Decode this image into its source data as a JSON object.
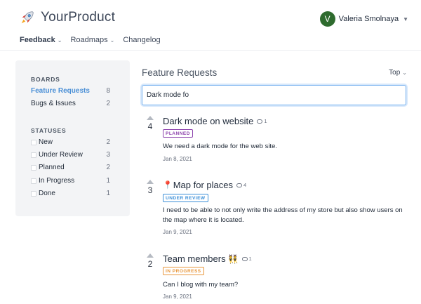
{
  "header": {
    "brand": "YourProduct",
    "user": {
      "initial": "V",
      "name": "Valeria Smolnaya"
    },
    "nav": [
      {
        "label": "Feedback",
        "active": true,
        "dropdown": true
      },
      {
        "label": "Roadmaps",
        "active": false,
        "dropdown": true
      },
      {
        "label": "Changelog",
        "active": false,
        "dropdown": false
      }
    ]
  },
  "sidebar": {
    "boards_title": "BOARDS",
    "boards": [
      {
        "name": "Feature Requests",
        "count": "8",
        "active": true
      },
      {
        "name": "Bugs & Issues",
        "count": "2",
        "active": false
      }
    ],
    "statuses_title": "STATUSES",
    "statuses": [
      {
        "name": "New",
        "count": "2"
      },
      {
        "name": "Under Review",
        "count": "3"
      },
      {
        "name": "Planned",
        "count": "2"
      },
      {
        "name": "In Progress",
        "count": "1"
      },
      {
        "name": "Done",
        "count": "1"
      }
    ]
  },
  "main": {
    "title": "Feature Requests",
    "sort": "Top",
    "search_value": "Dark mode fo",
    "posts": [
      {
        "votes": "4",
        "title": "Dark mode on website",
        "comments": "1",
        "status": "PLANNED",
        "status_color": "#8e44ad",
        "description": "We need a dark mode for the web site.",
        "date": "Jan 8, 2021"
      },
      {
        "votes": "3",
        "title": "Map for places",
        "title_prefix": "📍",
        "comments": "4",
        "status": "UNDER REVIEW",
        "status_color": "#3b8fd8",
        "description": "I need to be able to not only write the address of my store but also show users on the map where it is located.",
        "date": "Jan 9, 2021"
      },
      {
        "votes": "2",
        "title": "Team members",
        "title_suffix": "👯",
        "comments": "1",
        "status": "IN PROGRESS",
        "status_color": "#e8963a",
        "description": "Can I blog with my team?",
        "date": "Jan 9, 2021"
      }
    ]
  },
  "icons": {
    "logo": "rocket-icon",
    "comment": "comment-bubble-icon",
    "upvote": "upvote-arrow-icon",
    "chevron": "chevron-down-icon"
  }
}
